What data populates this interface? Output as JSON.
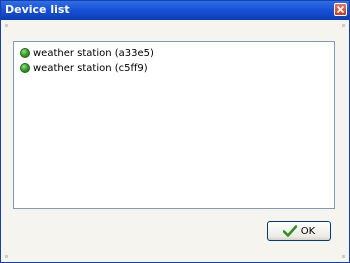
{
  "window": {
    "title": "Device list",
    "title_bar_color": "#1852d6",
    "close_icon": "close-icon"
  },
  "device_list": {
    "items": [
      {
        "label": "weather station (a33e5)",
        "status_color": "#2e9c22",
        "icon": "status-dot-icon"
      },
      {
        "label": "weather station (c5ff9)",
        "status_color": "#2e9c22",
        "icon": "status-dot-icon"
      }
    ]
  },
  "ok_button": {
    "label": "OK",
    "icon": "checkmark-icon",
    "icon_color": "#2f8f1f"
  }
}
